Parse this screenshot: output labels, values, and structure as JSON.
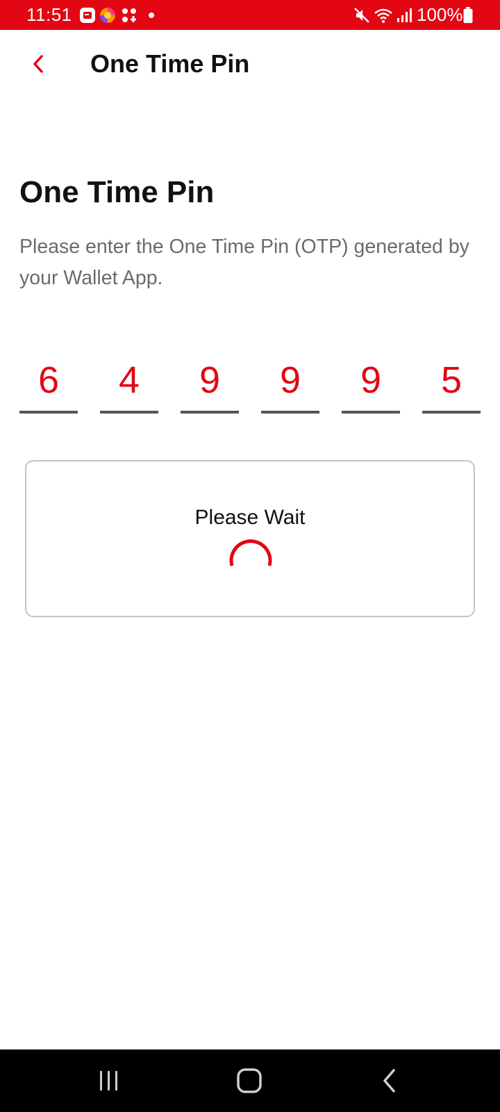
{
  "status_bar": {
    "time": "11:51",
    "battery_text": "100%",
    "background_color": "#e30613",
    "icons": [
      "notification-app-icon",
      "firefox-icon",
      "apps-icon",
      "dot-icon",
      "mute-icon",
      "wifi-icon",
      "signal-icon",
      "battery-icon"
    ]
  },
  "app_bar": {
    "title": "One Time Pin",
    "back_icon": "chevron-left-icon"
  },
  "content": {
    "heading": "One Time Pin",
    "description": "Please enter the One Time Pin (OTP) generated by your Wallet App."
  },
  "otp": {
    "digits": [
      "6",
      "4",
      "9",
      "9",
      "9",
      "5"
    ]
  },
  "wait_card": {
    "text": "Please Wait",
    "spinner_icon": "loading-spinner-icon"
  },
  "nav_bar": {
    "icons": [
      "recents-icon",
      "home-icon",
      "back-icon"
    ]
  },
  "colors": {
    "accent": "#e30613",
    "text_primary": "#111111",
    "text_secondary": "#6b6b6b",
    "underline": "#555555"
  }
}
